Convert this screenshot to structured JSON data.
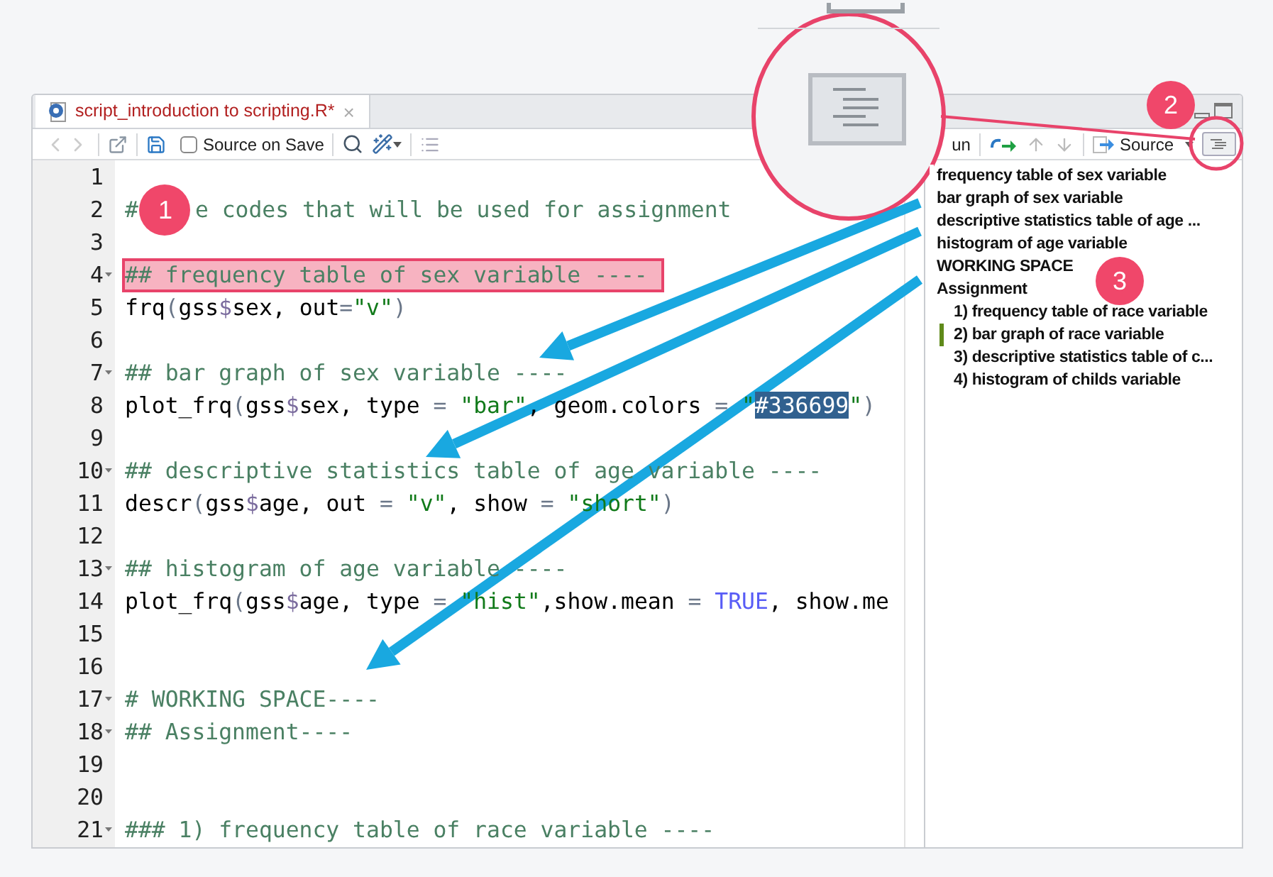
{
  "editor": {
    "tab": {
      "title": "script_introduction to scripting.R*",
      "modified": true,
      "close": "×"
    },
    "toolbar": {
      "source_on_save": {
        "label": "Source on Save",
        "checked": false
      },
      "run_label": "un",
      "source_label": "Source"
    },
    "lines": [
      {
        "number": "1",
        "fold": false,
        "highlight": false
      },
      {
        "number": "2",
        "fold": false,
        "highlight": false,
        "segments": [
          {
            "kind": "comment",
            "text": "#"
          },
          {
            "kind": "badge",
            "text": "1"
          },
          {
            "kind": "comment",
            "text": "e codes that will be used for assignment"
          }
        ]
      },
      {
        "number": "3",
        "fold": false,
        "highlight": false
      },
      {
        "number": "4",
        "fold": true,
        "highlight": true,
        "segments": [
          {
            "kind": "comment",
            "text": "## frequency table of sex variable ----"
          }
        ]
      },
      {
        "number": "5",
        "fold": false,
        "highlight": false,
        "segments": [
          {
            "kind": "plain",
            "text": "frq"
          },
          {
            "kind": "operator",
            "text": "("
          },
          {
            "kind": "plain",
            "text": "gss"
          },
          {
            "kind": "dollar",
            "text": "$"
          },
          {
            "kind": "plain",
            "text": "sex, out"
          },
          {
            "kind": "operator",
            "text": "="
          },
          {
            "kind": "string",
            "text": "\"v\""
          },
          {
            "kind": "operator",
            "text": ")"
          }
        ]
      },
      {
        "number": "6",
        "fold": false,
        "highlight": false
      },
      {
        "number": "7",
        "fold": true,
        "highlight": false,
        "segments": [
          {
            "kind": "comment",
            "text": "## bar graph of sex variable ----"
          }
        ]
      },
      {
        "number": "8",
        "fold": false,
        "highlight": false,
        "segments": [
          {
            "kind": "plain",
            "text": "plot_frq"
          },
          {
            "kind": "operator",
            "text": "("
          },
          {
            "kind": "plain",
            "text": "gss"
          },
          {
            "kind": "dollar",
            "text": "$"
          },
          {
            "kind": "plain",
            "text": "sex, type "
          },
          {
            "kind": "operator",
            "text": "="
          },
          {
            "kind": "string",
            "text": " \"bar\""
          },
          {
            "kind": "plain",
            "text": ", geom.colors "
          },
          {
            "kind": "operator",
            "text": "="
          },
          {
            "kind": "string",
            "text": " \""
          },
          {
            "kind": "selected",
            "text": "#336699"
          },
          {
            "kind": "string",
            "text": "\""
          },
          {
            "kind": "operator",
            "text": ")"
          }
        ]
      },
      {
        "number": "9",
        "fold": false,
        "highlight": false
      },
      {
        "number": "10",
        "fold": true,
        "highlight": false,
        "segments": [
          {
            "kind": "comment",
            "text": "## descriptive statistics table of age variable ----"
          }
        ]
      },
      {
        "number": "11",
        "fold": false,
        "highlight": false,
        "segments": [
          {
            "kind": "plain",
            "text": "descr"
          },
          {
            "kind": "operator",
            "text": "("
          },
          {
            "kind": "plain",
            "text": "gss"
          },
          {
            "kind": "dollar",
            "text": "$"
          },
          {
            "kind": "plain",
            "text": "age, out "
          },
          {
            "kind": "operator",
            "text": "="
          },
          {
            "kind": "string",
            "text": " \"v\""
          },
          {
            "kind": "plain",
            "text": ", show "
          },
          {
            "kind": "operator",
            "text": "="
          },
          {
            "kind": "string",
            "text": " \"short\""
          },
          {
            "kind": "operator",
            "text": ")"
          }
        ]
      },
      {
        "number": "12",
        "fold": false,
        "highlight": false
      },
      {
        "number": "13",
        "fold": true,
        "highlight": false,
        "segments": [
          {
            "kind": "comment",
            "text": "## histogram of age variable ----"
          }
        ]
      },
      {
        "number": "14",
        "fold": false,
        "highlight": false,
        "segments": [
          {
            "kind": "plain",
            "text": "plot_frq"
          },
          {
            "kind": "operator",
            "text": "("
          },
          {
            "kind": "plain",
            "text": "gss"
          },
          {
            "kind": "dollar",
            "text": "$"
          },
          {
            "kind": "plain",
            "text": "age, type "
          },
          {
            "kind": "operator",
            "text": "="
          },
          {
            "kind": "string",
            "text": " \"hist\""
          },
          {
            "kind": "plain",
            "text": ",show.mean "
          },
          {
            "kind": "operator",
            "text": "="
          },
          {
            "kind": "boolean",
            "text": " TRUE"
          },
          {
            "kind": "plain",
            "text": ", show.me"
          }
        ]
      },
      {
        "number": "15",
        "fold": false,
        "highlight": false
      },
      {
        "number": "16",
        "fold": false,
        "highlight": false
      },
      {
        "number": "17",
        "fold": true,
        "highlight": false,
        "segments": [
          {
            "kind": "comment",
            "text": "# WORKING SPACE----"
          }
        ]
      },
      {
        "number": "18",
        "fold": true,
        "highlight": false,
        "segments": [
          {
            "kind": "comment",
            "text": "## Assignment----"
          }
        ]
      },
      {
        "number": "19",
        "fold": false,
        "highlight": false
      },
      {
        "number": "20",
        "fold": false,
        "highlight": false
      },
      {
        "number": "21",
        "fold": true,
        "highlight": false,
        "segments": [
          {
            "kind": "comment",
            "text": "### 1) frequency table of race variable ----"
          }
        ]
      }
    ]
  },
  "outline": {
    "items": [
      {
        "label": "frequency table of sex variable",
        "selected": false
      },
      {
        "label": "bar graph of sex variable",
        "selected": false
      },
      {
        "label": "descriptive statistics table of age ...",
        "selected": false
      },
      {
        "label": "histogram of age variable",
        "selected": false
      },
      {
        "label": "WORKING SPACE",
        "selected": false
      },
      {
        "label": "Assignment",
        "selected": false,
        "children": [
          {
            "label": "1) frequency table of race variable",
            "selected": false
          },
          {
            "label": "2) bar graph of race variable",
            "selected": true
          },
          {
            "label": "3) descriptive statistics table of c...",
            "selected": false
          },
          {
            "label": "4) histogram of childs variable",
            "selected": false
          }
        ]
      }
    ]
  },
  "annotations": {
    "badges": [
      {
        "label": "2"
      },
      {
        "label": "3"
      }
    ]
  }
}
